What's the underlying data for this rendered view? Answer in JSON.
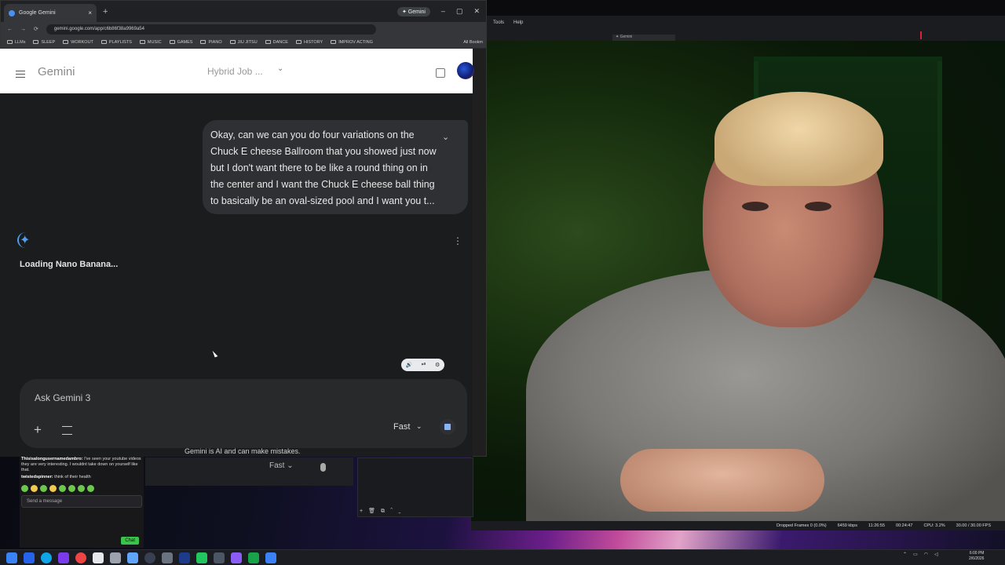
{
  "browser": {
    "tab_title": "Google Gemini",
    "tab_close": "×",
    "new_tab": "+",
    "gemini_pill": "✦ Gemini",
    "window_buttons": [
      "–",
      "▢",
      "✕"
    ],
    "url": "gemini.google.com/app/c6b86f38a9969a54",
    "nav_icons": [
      "←",
      "→",
      "⟳"
    ],
    "bookmarks": [
      "LLMs",
      "SLEEP",
      "WORKOUT",
      "PLAYLISTS",
      "MUSIC",
      "GAMES",
      "PIANO",
      "JIU JITSU",
      "DANCE",
      "HISTORY",
      "IMPROV ACTING"
    ],
    "all_bookmarks": "All Bookm"
  },
  "gemini": {
    "app_title": "Gemini",
    "chat_title": "Hybrid Job ...",
    "chat_chevron": "⌄",
    "user_message": "Okay, can we can you do four variations on the Chuck E cheese Ballroom that you showed just now but I don't want there to be like a round thing on in the center and I want the Chuck E cheese ball thing to basically be an oval-sized pool and I want you t...",
    "expand_icon": "⌄",
    "spark_icon": "✦",
    "more_icon": "⋮",
    "loading_text": "Loading Nano Banana...",
    "media_controls": [
      "🔊",
      "⏯",
      "⚙"
    ],
    "input_placeholder": "Ask Gemini 3",
    "plus_icon": "+",
    "model_label": "Fast",
    "model_chevron": "⌄",
    "disclaimer": "Gemini is AI and can make mistakes."
  },
  "chat_widget": {
    "messages": [
      {
        "name": "Thisisalongusernamedambro:",
        "text": " I've seen your youtube videos they are very interesting. I wouldnt take down on yourself like that."
      },
      {
        "name": "twistedspinner:",
        "text": " think of their health"
      }
    ],
    "send_placeholder": "Send a message",
    "chat_button": "Chat"
  },
  "background_window": {
    "model_label": "Fast",
    "model_chevron": "⌄"
  },
  "obs": {
    "menu": [
      "Tools",
      "Help"
    ],
    "mini_title": "✦ Gemini",
    "controls": [
      "+",
      "🗑",
      "⧉",
      "⌃",
      "⌄"
    ],
    "status": [
      "Dropped Frames 0 (0.0%)",
      "6459 kbps",
      "11:26:55",
      "00:24:47",
      "CPU: 3.2%",
      "30.00 / 30.00 FPS"
    ]
  },
  "taskbar": {
    "clock_time": "6:00 PM",
    "clock_date": "2/6/2026"
  }
}
